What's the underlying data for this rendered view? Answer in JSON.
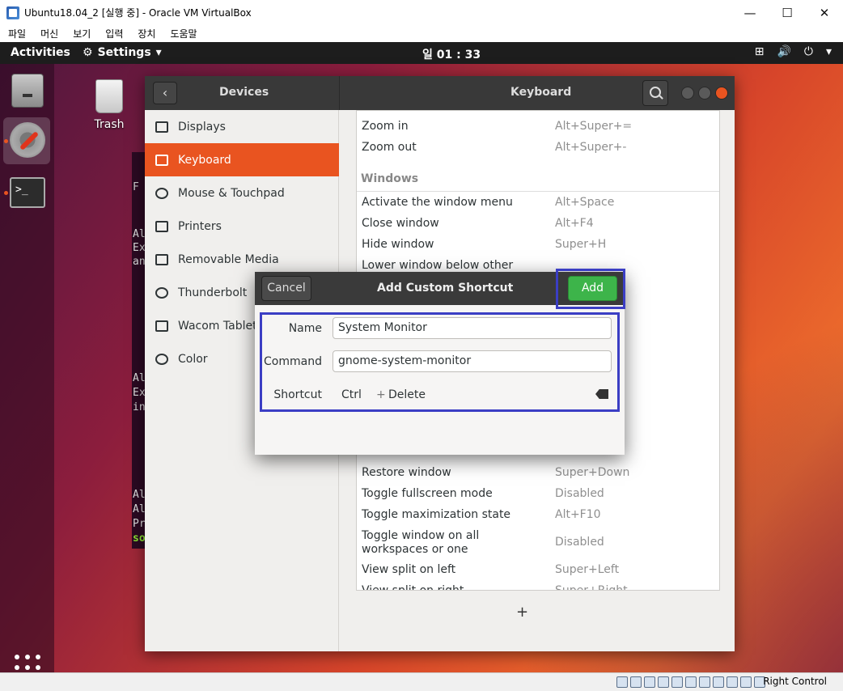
{
  "host": {
    "title": "Ubuntu18.04_2 [실행 중] - Oracle VM VirtualBox",
    "controls": [
      "—",
      "☐",
      "✕"
    ],
    "menu": [
      "파일",
      "머신",
      "보기",
      "입력",
      "장치",
      "도움말"
    ],
    "status_right": "Right Control"
  },
  "topbar": {
    "activities": "Activities",
    "app_menu": "Settings",
    "app_menu_arrow": "▾",
    "clock": "일 01 : 33",
    "tray_icons": [
      "network-icon",
      "volume-icon",
      "power-icon",
      "menu-arrow-icon"
    ],
    "tray_glyphs": [
      "⊞",
      "🔊",
      "⏻",
      "▾"
    ]
  },
  "desktop": {
    "trash_label": "Trash"
  },
  "terminal_fragments": [
    "F",
    "Al",
    "Ex",
    "an",
    "Al",
    "Ex",
    "in",
    "Al",
    "Al",
    "Pr",
    "so"
  ],
  "settings": {
    "left_title": "Devices",
    "back_glyph": "‹",
    "title": "Keyboard",
    "sidebar": [
      {
        "label": "Displays"
      },
      {
        "label": "Keyboard"
      },
      {
        "label": "Mouse & Touchpad"
      },
      {
        "label": "Printers"
      },
      {
        "label": "Removable Media"
      },
      {
        "label": "Thunderbolt"
      },
      {
        "label": "Wacom Tablet"
      },
      {
        "label": "Color"
      }
    ],
    "rows_top": [
      {
        "name": "Zoom in",
        "key": "Alt+Super+="
      },
      {
        "name": "Zoom out",
        "key": "Alt+Super+-"
      }
    ],
    "section": "Windows",
    "rows_windows": [
      {
        "name": "Activate the window menu",
        "key": "Alt+Space"
      },
      {
        "name": "Close window",
        "key": "Alt+F4"
      },
      {
        "name": "Hide window",
        "key": "Super+H"
      },
      {
        "name": "Lower window below other",
        "key": ""
      }
    ],
    "rows_bottom": [
      {
        "name": "Restore window",
        "key": "Super+Down"
      },
      {
        "name": "Toggle fullscreen mode",
        "key": "Disabled"
      },
      {
        "name": "Toggle maximization state",
        "key": "Alt+F10"
      },
      {
        "name": "Toggle window on all",
        "name2": "workspaces or one",
        "key": "Disabled"
      },
      {
        "name": "View split on left",
        "key": "Super+Left"
      },
      {
        "name": "View split on right",
        "key": "Super+Right"
      }
    ],
    "add_glyph": "+"
  },
  "dialog": {
    "cancel": "Cancel",
    "title": "Add Custom Shortcut",
    "add": "Add",
    "name_label": "Name",
    "name_value": "System Monitor",
    "command_label": "Command",
    "command_value": "gnome-system-monitor",
    "shortcut_label": "Shortcut",
    "shortcut_value": "Ctrl",
    "shortcut_plus": "+",
    "shortcut_key": "Delete"
  },
  "highlight_color": "#3b3ec4",
  "accent": "#e95420"
}
